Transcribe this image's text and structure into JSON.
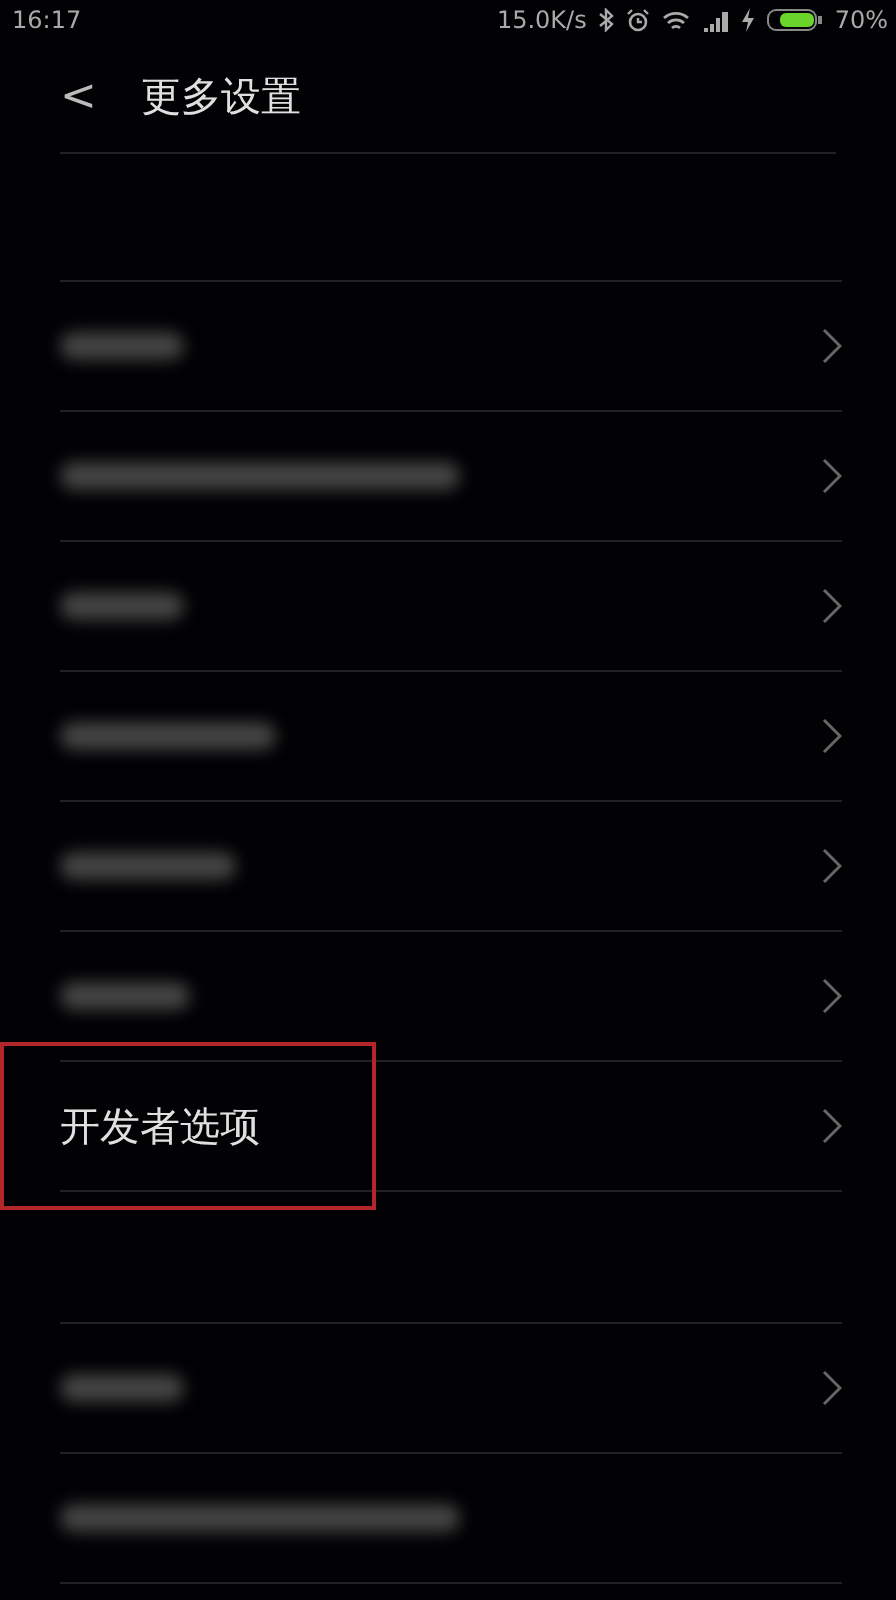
{
  "status_bar": {
    "time": "16:17",
    "speed": "15.0K/s",
    "battery": "70%"
  },
  "header": {
    "back": "<",
    "title": "更多设置"
  },
  "groups": [
    {
      "rows": [
        {
          "kind": "blurred",
          "chevron": true,
          "annotated": false
        },
        {
          "kind": "blurred",
          "chevron": true,
          "annotated": false
        },
        {
          "kind": "blurred",
          "chevron": true,
          "annotated": false
        },
        {
          "kind": "blurred",
          "chevron": true,
          "annotated": false
        },
        {
          "kind": "blurred",
          "chevron": true,
          "annotated": false
        },
        {
          "kind": "blurred",
          "chevron": true,
          "annotated": false
        },
        {
          "kind": "text",
          "label": "开发者选项",
          "chevron": true,
          "annotated": true
        }
      ]
    },
    {
      "rows": [
        {
          "kind": "blurred",
          "chevron": true,
          "annotated": false
        },
        {
          "kind": "blurred",
          "chevron": false,
          "annotated": false
        }
      ]
    }
  ]
}
